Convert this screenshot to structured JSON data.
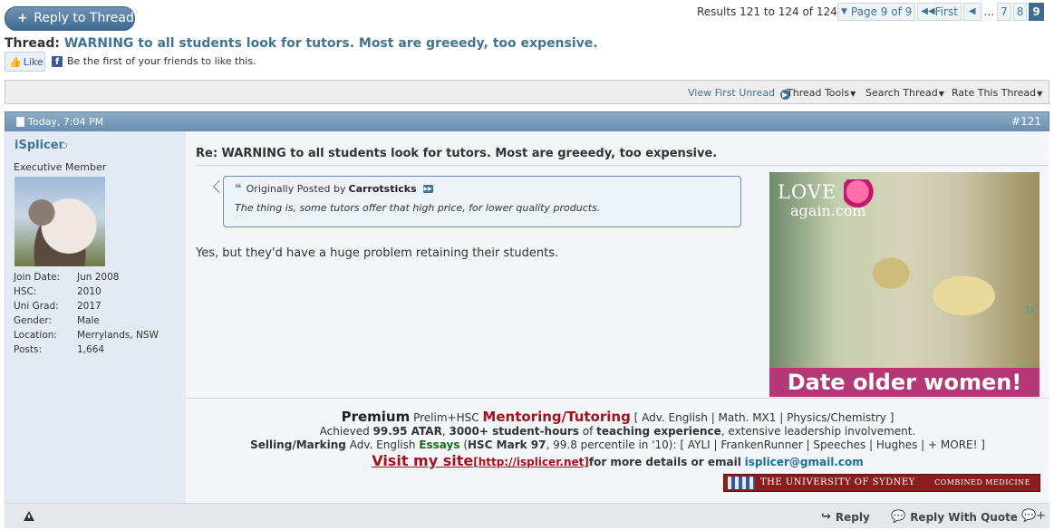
{
  "top": {
    "reply_button": "Reply to Thread",
    "results": "Results 121 to 124 of 124",
    "pagination": {
      "page_dropdown": "Page 9 of 9",
      "first": "First",
      "prev": "◀",
      "ellipsis": "...",
      "pages": [
        "7",
        "8",
        "9"
      ],
      "current_page": "9"
    },
    "thread_label": "Thread:",
    "thread_title": "WARNING to all students look for tutors. Most are greeedy, too expensive.",
    "like_button": "Like",
    "like_text": "Be the first of your friends to like this."
  },
  "tools_bar": {
    "view_first_unread": "View First Unread",
    "thread_tools": "Thread Tools",
    "search_thread": "Search Thread",
    "rate_thread": "Rate This Thread"
  },
  "post": {
    "date": "Today, 7:04 PM",
    "number": "#121",
    "user": {
      "name": "iSplicer",
      "title": "Executive Member",
      "stats": [
        {
          "k": "Join Date:",
          "v": "Jun 2008"
        },
        {
          "k": "HSC:",
          "v": "2010"
        },
        {
          "k": "Uni Grad:",
          "v": "2017"
        },
        {
          "k": "Gender:",
          "v": "Male"
        },
        {
          "k": "Location:",
          "v": "Merrylands, NSW"
        },
        {
          "k": "Posts:",
          "v": "1,664"
        }
      ]
    },
    "title": "Re: WARNING to all students look for tutors. Most are greeedy, too expensive.",
    "quote": {
      "prefix": "Originally Posted by",
      "author": "Carrotsticks",
      "text": "The thing is, some tutors offer that high price, for lower quality products."
    },
    "message": "Yes, but they'd have a huge problem retaining their students.",
    "ad": {
      "logo": "LOVE",
      "logo_sub": "again.com",
      "banner": "Date older women!"
    },
    "signature": {
      "premium": "Premium",
      "prelim": "Prelim+HSC",
      "mentoring": "Mentoring/Tutoring",
      "subjects": "[ Adv. English | Math. MX1 | Physics/Chemistry ]",
      "achieved": "Achieved",
      "atar": "99.95 ATAR",
      "comma1": ",",
      "hours": "3000+ student-hours",
      "of": "of",
      "teaching": "teaching experience",
      "leadership": ", extensive leadership involvement.",
      "selling": "Selling/Marking",
      "adv_english": "Adv. English",
      "essays": "Essays",
      "hsc_mark_pre": "(",
      "hsc_mark": "HSC Mark 97",
      "percentile": ", 99.8 percentile in '10): [ AYLI | FrankenRunner | Speeches | Hughes | + MORE! ]",
      "visit": "Visit my site",
      "url": "[http://isplicer.net]",
      "for_more": "for more details or email",
      "email": "isplicer@gmail.com",
      "banner_name": "THE UNIVERSITY OF SYDNEY",
      "banner_right": "COMBINED MEDICINE"
    },
    "footer": {
      "reply": "Reply",
      "reply_quote": "Reply With Quote"
    }
  }
}
